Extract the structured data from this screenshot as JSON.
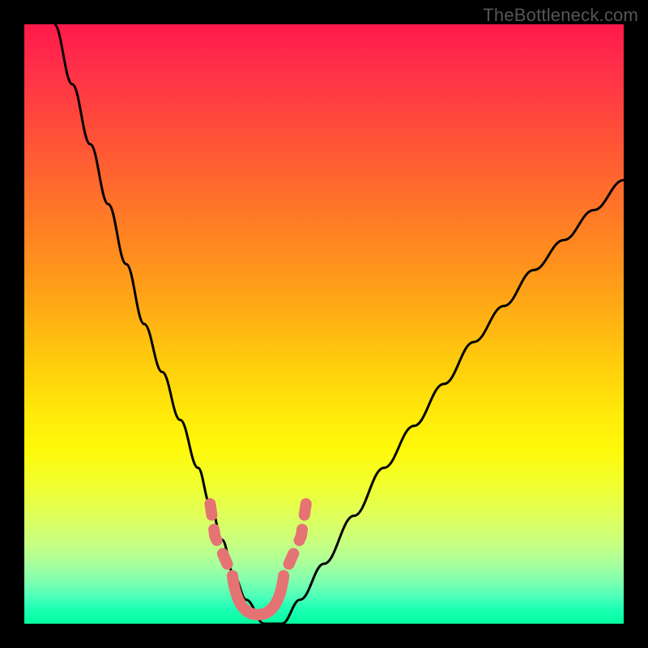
{
  "watermark": "TheBottleneck.com",
  "chart_data": {
    "type": "line",
    "title": "",
    "xlabel": "",
    "ylabel": "",
    "xlim": [
      0,
      100
    ],
    "ylim": [
      0,
      100
    ],
    "grid": false,
    "background_gradient": {
      "top": "#ff1a4a",
      "middle": "#ffff00",
      "bottom": "#00ff9e"
    },
    "series": [
      {
        "name": "bottleneck-curve",
        "x": [
          5,
          8,
          11,
          14,
          17,
          20,
          23,
          26,
          29,
          31,
          33,
          35,
          37,
          40,
          43,
          46,
          50,
          55,
          60,
          65,
          70,
          75,
          80,
          85,
          90,
          95,
          100
        ],
        "y": [
          100,
          90,
          80,
          70,
          60,
          50,
          42,
          34,
          26,
          20,
          14,
          8,
          4,
          0,
          0,
          4,
          10,
          18,
          26,
          33,
          40,
          47,
          53,
          59,
          64,
          69,
          74
        ]
      }
    ],
    "annotation": {
      "type": "highlight",
      "color": "#e57373",
      "description": "rounded-U marker near curve minimum with dashed arms",
      "x_range": [
        31,
        47
      ],
      "y_range": [
        0,
        20
      ]
    }
  }
}
